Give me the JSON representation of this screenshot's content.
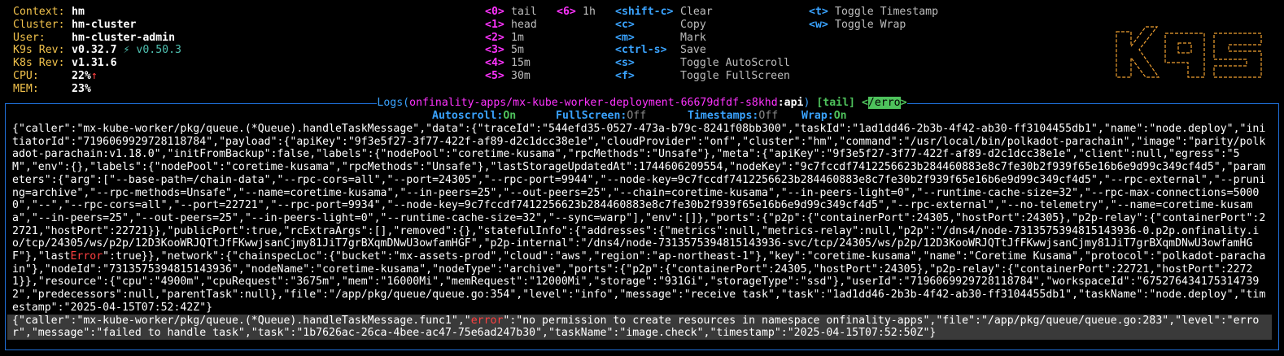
{
  "cluster_info": [
    {
      "label": "Context:",
      "value": "hm"
    },
    {
      "label": "Cluster:",
      "value": "hm-cluster"
    },
    {
      "label": "User:",
      "value": "hm-cluster-admin"
    },
    {
      "label": "K9s Rev:",
      "value": "v0.32.7",
      "extra": " ⚡ v0.50.3"
    },
    {
      "label": "K8s Rev:",
      "value": "v1.31.6"
    },
    {
      "label": "CPU:",
      "value": "22%",
      "trend": "↑"
    },
    {
      "label": "MEM:",
      "value": "23%"
    }
  ],
  "hotkeys_col1": [
    {
      "key": "<0>",
      "desc": "tail"
    },
    {
      "key": "<1>",
      "desc": "head"
    },
    {
      "key": "<2>",
      "desc": "1m"
    },
    {
      "key": "<3>",
      "desc": "5m"
    },
    {
      "key": "<4>",
      "desc": "15m"
    },
    {
      "key": "<5>",
      "desc": "30m"
    }
  ],
  "hotkeys_col2": [
    {
      "key": "<6>",
      "desc": "1h"
    }
  ],
  "hotkeys_col3": [
    {
      "key": "<shift-c>",
      "desc": "Clear"
    },
    {
      "key": "<c>",
      "desc": "Copy"
    },
    {
      "key": "<m>",
      "desc": "Mark"
    },
    {
      "key": "<ctrl-s>",
      "desc": "Save"
    },
    {
      "key": "<s>",
      "desc": "Toggle AutoScroll"
    },
    {
      "key": "<f>",
      "desc": "Toggle FullScreen"
    }
  ],
  "hotkeys_col4": [
    {
      "key": "<t>",
      "desc": "Toggle Timestamp"
    },
    {
      "key": "<w>",
      "desc": "Toggle Wrap"
    }
  ],
  "logo_icon": "k9s-ascii-logo",
  "logs_view": {
    "title_prefix": " Logs(",
    "path": "onfinality-apps/mx-kube-worker-deployment-66679dfdf-s8khd",
    "container": ":api",
    "close_paren": ")",
    "mode": "[tail]",
    "filter_open": "<",
    "filter": "/erro",
    "filter_close": ">",
    "status": [
      {
        "label": "Autoscroll:",
        "value": "On",
        "on": true
      },
      {
        "label": "FullScreen:",
        "value": "Off",
        "on": false
      },
      {
        "label": "Timestamps:",
        "value": "Off",
        "on": false
      },
      {
        "label": "Wrap:",
        "value": "On",
        "on": true
      }
    ],
    "log_lines": [
      {
        "before": "{\"caller\":\"mx-kube-worker/pkg/queue.(*Queue).handleTaskMessage\",\"data\":{\"traceId\":\"544efd35-0527-473a-b79c-8241f08bb300\",\"taskId\":\"1ad1dd46-2b3b-4f42-ab30-ff3104455db1\",\"name\":\"node.deploy\",\"initiatorId\":\"7196069929728118784\",\"payload\":{\"apiKey\":\"9f3e5f27-3f77-422f-af89-d2c1dcc38e1e\",\"cloudProvider\":\"onf\",\"cluster\":\"hm\",\"command\":\"/usr/local/bin/polkadot-parachain\",\"image\":\"parity/polkadot-parachain:v1.18.0\",\"initFromBackup\":false,\"labels\":{\"nodePool\":\"coretime-kusama\",\"rpcMethods\":\"Unsafe\"},\"meta\":{\"apiKey\":\"9f3e5f27-3f77-422f-af89-d2c1dcc38e1e\",\"client\":null,\"egress\":\"5M\",\"env\":{},\"labels\":{\"nodePool\":\"coretime-kusama\",\"rpcMethods\":\"Unsafe\"},\"lastStorageUpdatedAt\":1744606209554,\"nodeKey\":\"9c7fccdf7412256623b284460883e8c7fe30b2f939f65e16b6e9d99c349cf4d5\",\"parameters\":{\"arg\":[\"--base-path=/chain-data\",\"--rpc-cors=all\",\"--port=24305\",\"--rpc-port=9944\",\"--node-key=9c7fccdf7412256623b284460883e8c7fe30b2f939f65e16b6e9d99c349cf4d5\",\"--rpc-external\",\"--pruning=archive\",\"--rpc-methods=Unsafe\",\"--name=coretime-kusama\",\"--in-peers=25\",\"--out-peers=25\",\"--chain=coretime-kusama\",\"--in-peers-light=0\",\"--runtime-cache-size=32\",\"--rpc-max-connections=50000\",\"--\",\"--rpc-cors=all\",\"--port=22721\",\"--rpc-port=9934\",\"--node-key=9c7fccdf7412256623b284460883e8c7fe30b2f939f65e16b6e9d99c349cf4d5\",\"--rpc-external\",\"--no-telemetry\",\"--name=coretime-kusama\",\"--in-peers=25\",\"--out-peers=25\",\"--in-peers-light=0\",\"--runtime-cache-size=32\",\"--sync=warp\"],\"env\":[]},\"ports\":{\"p2p\":{\"containerPort\":24305,\"hostPort\":24305},\"p2p-relay\":{\"containerPort\":22721,\"hostPort\":22721}},\"publicPort\":true,\"rcExtraArgs\":[],\"removed\":{},\"statefulInfo\":{\"addresses\":{\"metrics\":null,\"metrics-relay\":null,\"p2p\":\"/dns4/node-7313575394815143936-0.p2p.onfinality.io/tcp/24305/ws/p2p/12D3KooWRJQTtJfFKwwjsanCjmy81JiT7grBXqmDNwU3owfamHGF\",\"p2p-internal\":\"/dns4/node-7313575394815143936-svc/tcp/24305/ws/p2p/12D3KooWRJQTtJfFKwwjsanCjmy81JiT7grBXqmDNwU3owfamHGF\"},\"last",
        "match": "Error",
        "after": "\":true}},\"network\":{\"chainspecLoc\":{\"bucket\":\"mx-assets-prod\",\"cloud\":\"aws\",\"region\":\"ap-northeast-1\"},\"key\":\"coretime-kusama\",\"name\":\"Coretime Kusama\",\"protocol\":\"polkadot-parachain\"},\"nodeId\":\"7313575394815143936\",\"nodeName\":\"coretime-kusama\",\"nodeType\":\"archive\",\"ports\":{\"p2p\":{\"containerPort\":24305,\"hostPort\":24305},\"p2p-relay\":{\"containerPort\":22721,\"hostPort\":22721}},\"resource\":{\"cpu\":\"4900m\",\"cpuRequest\":\"3675m\",\"mem\":\"16000Mi\",\"memRequest\":\"12000Mi\",\"storage\":\"931Gi\",\"storageType\":\"ssd\"},\"userId\":\"7196069929728118784\",\"workspaceId\":\"6752764341753147392\",\"predecessors\":null,\"parentTask\":null},\"file\":\"/app/pkg/queue/queue.go:354\",\"level\":\"info\",\"message\":\"receive task\",\"task\":\"1ad1dd46-2b3b-4f42-ab30-ff3104455db1\",\"taskName\":\"node.deploy\",\"timestamp\":\"2025-04-15T07:52:42Z\"}"
      },
      {
        "before": "{\"caller\":\"mx-kube-worker/pkg/queue.(*Queue).handleTaskMessage.func1\",\"",
        "match": "error",
        "after": "\":\"no permission to create resources in namespace onfinality-apps\",\"file\":\"/app/pkg/queue/queue.go:283\",\"level\":\"error\",\"message\":\"failed to handle task\",\"task\":\"1b7626ac-26ca-4bee-ac47-75e6ad247b30\",\"taskName\":\"image.check\",\"timestamp\":\"2025-04-15T07:52:50Z\"}"
      }
    ]
  }
}
